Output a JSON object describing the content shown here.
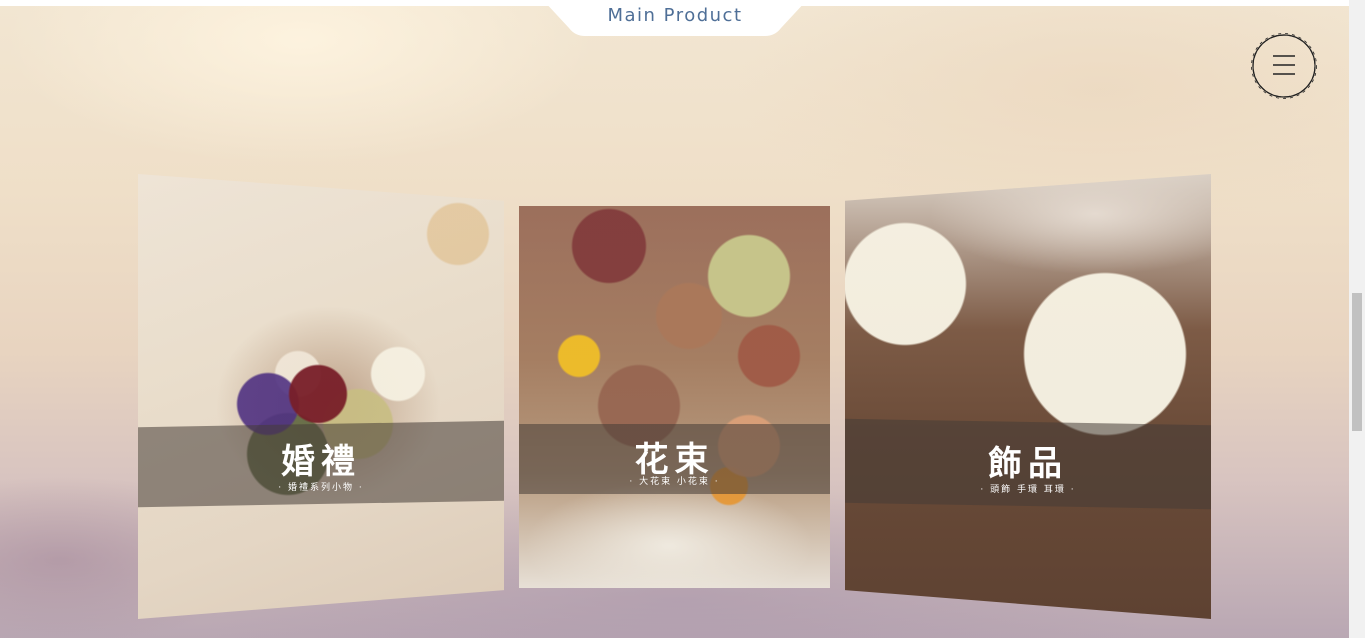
{
  "header": {
    "tab_label": "Main Product"
  },
  "menu": {
    "icon": "hamburger-menu-icon"
  },
  "products": [
    {
      "title": "婚禮",
      "subtitle": "· 婚禮系列小物 ·"
    },
    {
      "title": "花束",
      "subtitle": "· 大花束 小花束 ·"
    },
    {
      "title": "飾品",
      "subtitle": "· 頭飾 手環 耳環 ·"
    }
  ],
  "colors": {
    "tab_text": "#4f6f97",
    "menu_stroke": "#222222"
  }
}
